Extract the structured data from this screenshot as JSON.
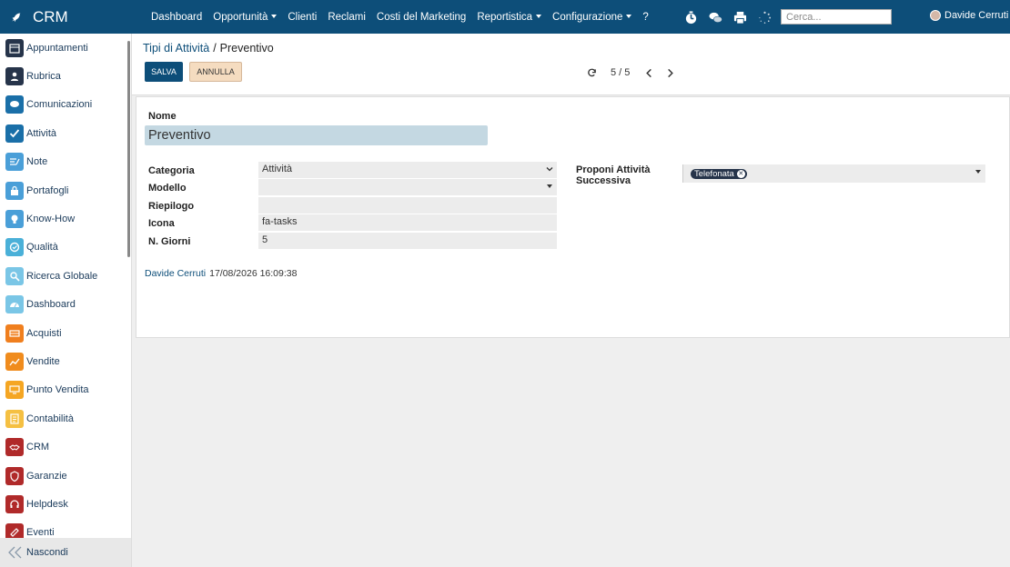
{
  "app": {
    "name": "CRM"
  },
  "nav": {
    "items": [
      {
        "label": "Dashboard",
        "dropdown": false
      },
      {
        "label": "Opportunità",
        "dropdown": true
      },
      {
        "label": "Clienti",
        "dropdown": false
      },
      {
        "label": "Reclami",
        "dropdown": false
      },
      {
        "label": "Costi del Marketing",
        "dropdown": false
      },
      {
        "label": "Reportistica",
        "dropdown": true
      },
      {
        "label": "Configurazione",
        "dropdown": true
      },
      {
        "label": "?",
        "dropdown": false
      }
    ],
    "search_placeholder": "Cerca...",
    "user_name": "Davide Cerruti"
  },
  "sidebar": {
    "items": [
      {
        "label": "Appuntamenti",
        "icon": "calendar-icon",
        "color": "#26344a"
      },
      {
        "label": "Rubrica",
        "icon": "contacts-icon",
        "color": "#26344a"
      },
      {
        "label": "Comunicazioni",
        "icon": "chat-icon",
        "color": "#1a6fa8"
      },
      {
        "label": "Attività",
        "icon": "check-icon",
        "color": "#1a6fa8"
      },
      {
        "label": "Note",
        "icon": "note-icon",
        "color": "#4a9fd8"
      },
      {
        "label": "Portafogli",
        "icon": "lock-icon",
        "color": "#4a9fd8"
      },
      {
        "label": "Know-How",
        "icon": "bulb-icon",
        "color": "#4a9fd8"
      },
      {
        "label": "Qualità",
        "icon": "quality-icon",
        "color": "#4ab0d8"
      },
      {
        "label": "Ricerca Globale",
        "icon": "search-icon",
        "color": "#7ac6e6"
      },
      {
        "label": "Dashboard",
        "icon": "dashboard-icon",
        "color": "#7ac6e6"
      },
      {
        "label": "Acquisti",
        "icon": "cart-icon",
        "color": "#f07f1e"
      },
      {
        "label": "Vendite",
        "icon": "chart-icon",
        "color": "#f08c1e"
      },
      {
        "label": "Punto Vendita",
        "icon": "pos-icon",
        "color": "#f5a623"
      },
      {
        "label": "Contabilità",
        "icon": "ledger-icon",
        "color": "#f5c042"
      },
      {
        "label": "CRM",
        "icon": "handshake-icon",
        "color": "#b02a2a"
      },
      {
        "label": "Garanzie",
        "icon": "shield-icon",
        "color": "#b02a2a"
      },
      {
        "label": "Helpdesk",
        "icon": "headset-icon",
        "color": "#b02a2a"
      },
      {
        "label": "Eventi",
        "icon": "ticket-icon",
        "color": "#b02a2a"
      }
    ],
    "collapse_label": "Nascondi"
  },
  "breadcrumb": {
    "parent": "Tipi di Attività",
    "separator": "/",
    "current": "Preventivo"
  },
  "buttons": {
    "save": "SALVA",
    "cancel": "ANNULLA"
  },
  "pager": {
    "value": "5 / 5"
  },
  "form": {
    "name_label": "Nome",
    "name_value": "Preventivo",
    "categoria_label": "Categoria",
    "categoria_value": "Attività",
    "modello_label": "Modello",
    "modello_value": "",
    "riepilogo_label": "Riepilogo",
    "riepilogo_value": "",
    "icona_label": "Icona",
    "icona_value": "fa-tasks",
    "giorni_label": "N. Giorni",
    "giorni_value": "5",
    "proponi_label_line1": "Proponi Attività",
    "proponi_label_line2": "Successiva",
    "proponi_tag": "Telefonata"
  },
  "audit": {
    "user": "Davide Cerruti",
    "date": "17/08/2026 16:09:38"
  },
  "colors": {
    "primary": "#0d4e79",
    "cancel_bg": "#f5dcc0",
    "name_field_bg": "#c4d8e2"
  }
}
